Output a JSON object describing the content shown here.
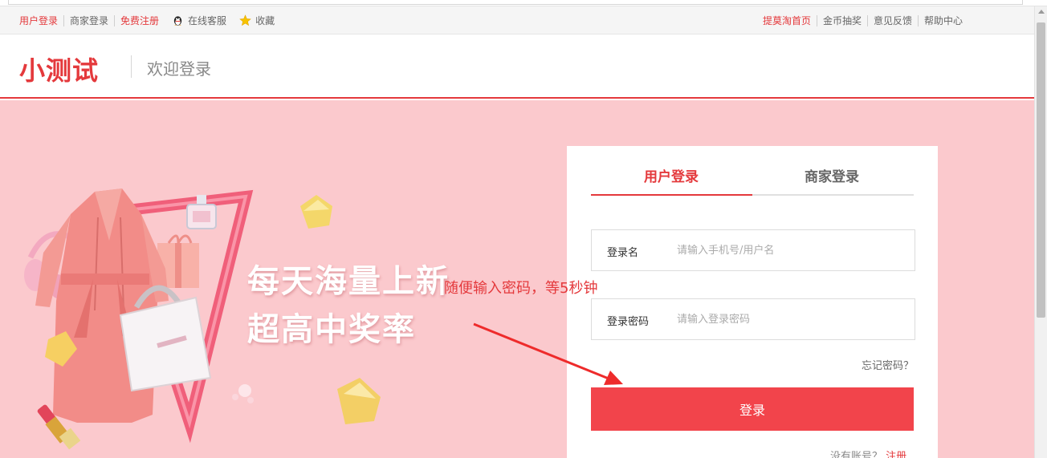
{
  "topbar": {
    "left_links": [
      "用户登录",
      "商家登录",
      "免费注册"
    ],
    "service": "在线客服",
    "favorite": "收藏",
    "right_links": [
      "提莫淘首页",
      "金币抽奖",
      "意见反馈",
      "帮助中心"
    ]
  },
  "header": {
    "logo": "小测试",
    "welcome": "欢迎登录"
  },
  "banner": {
    "slogan_line1": "每天海量上新",
    "slogan_line2": "超高中奖率"
  },
  "login": {
    "tabs": [
      "用户登录",
      "商家登录"
    ],
    "username_label": "登录名",
    "username_placeholder": "请输入手机号/用户名",
    "password_label": "登录密码",
    "password_placeholder": "请输入登录密码",
    "forgot": "忘记密码？",
    "submit": "登录",
    "no_account": "没有账号？",
    "register": "注册"
  },
  "annotation": {
    "text": "随便输入密码，等5秒钟"
  },
  "colors": {
    "accent": "#e4393c",
    "banner_bg": "#fbc9cd",
    "button": "#f2444b"
  }
}
